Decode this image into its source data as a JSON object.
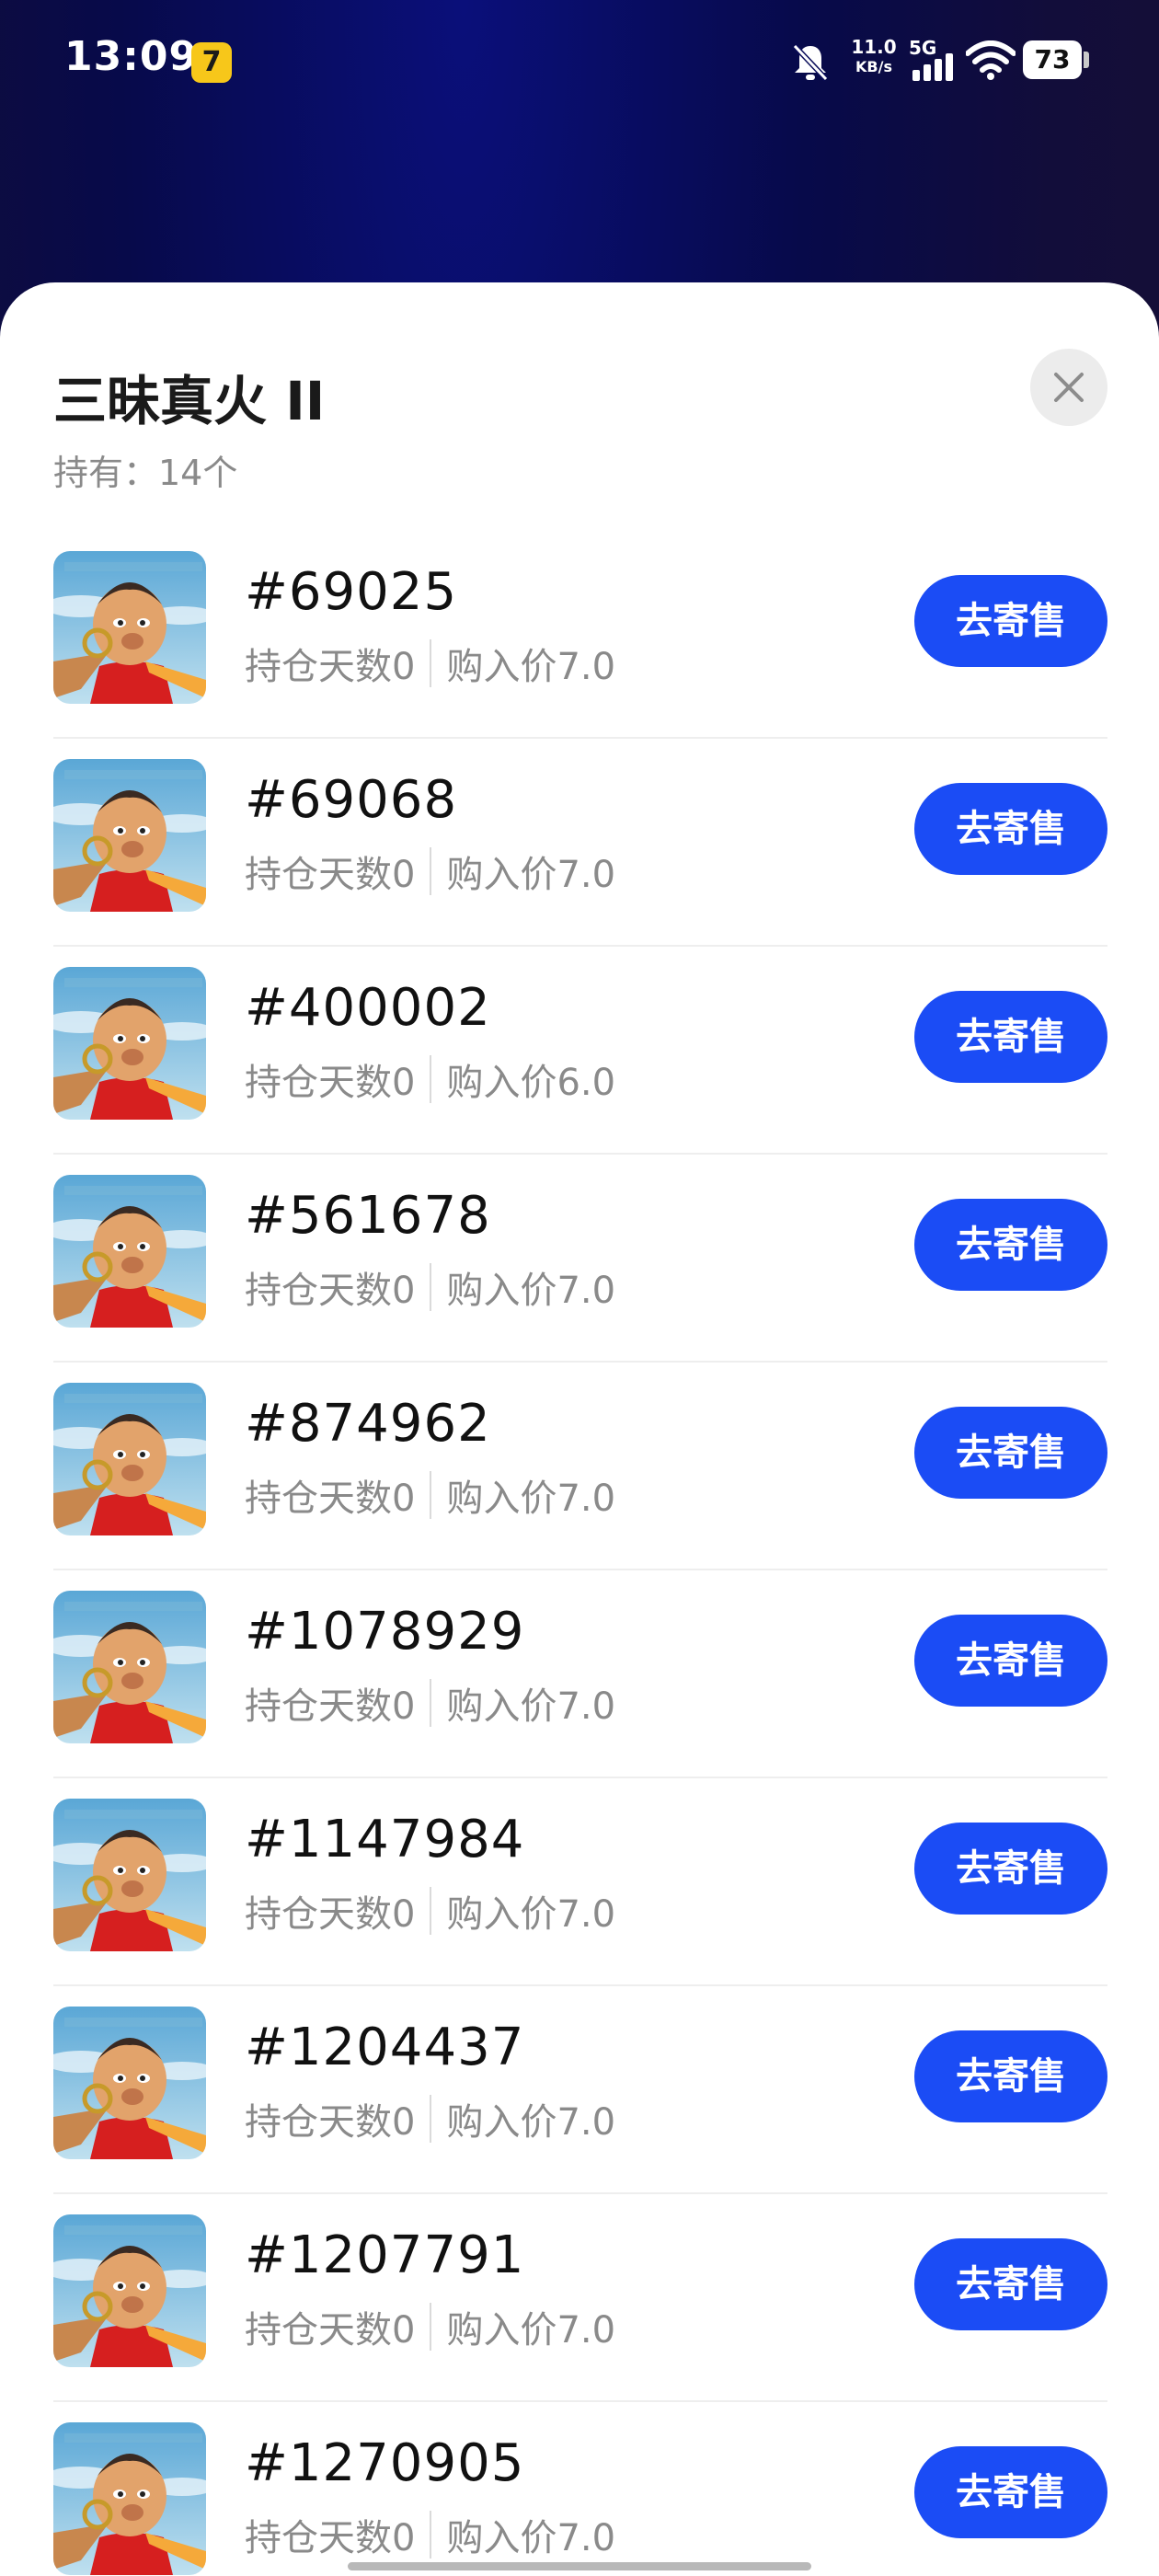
{
  "status_bar": {
    "time": "13:09",
    "app_badge": "7",
    "net_speed_value": "11.0",
    "net_speed_unit": "KB/s",
    "network": "5G",
    "battery": "73",
    "icons": [
      "mute-bell-icon",
      "signal-icon",
      "wifi-icon",
      "battery-icon"
    ]
  },
  "sheet": {
    "title": "三昧真火 II",
    "holding": "持有：14个",
    "close_icon": "close-icon"
  },
  "items": [
    {
      "id": "#69025",
      "days": "持仓天数0",
      "price": "购入价7.0",
      "button": "去寄售"
    },
    {
      "id": "#69068",
      "days": "持仓天数0",
      "price": "购入价7.0",
      "button": "去寄售"
    },
    {
      "id": "#400002",
      "days": "持仓天数0",
      "price": "购入价6.0",
      "button": "去寄售"
    },
    {
      "id": "#561678",
      "days": "持仓天数0",
      "price": "购入价7.0",
      "button": "去寄售"
    },
    {
      "id": "#874962",
      "days": "持仓天数0",
      "price": "购入价7.0",
      "button": "去寄售"
    },
    {
      "id": "#1078929",
      "days": "持仓天数0",
      "price": "购入价7.0",
      "button": "去寄售"
    },
    {
      "id": "#1147984",
      "days": "持仓天数0",
      "price": "购入价7.0",
      "button": "去寄售"
    },
    {
      "id": "#1204437",
      "days": "持仓天数0",
      "price": "购入价7.0",
      "button": "去寄售"
    },
    {
      "id": "#1207791",
      "days": "持仓天数0",
      "price": "购入价7.0",
      "button": "去寄售"
    },
    {
      "id": "#1270905",
      "days": "持仓天数0",
      "price": "购入价7.0",
      "button": "去寄售"
    }
  ],
  "colors": {
    "accent": "#1b4cf5",
    "background_top": "#070a4a"
  }
}
